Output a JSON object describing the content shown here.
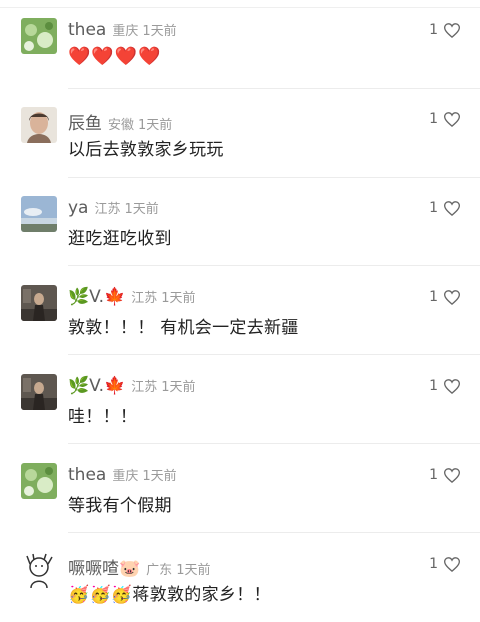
{
  "comments": [
    {
      "username": "thea",
      "location": "重庆",
      "time": "1天前",
      "text": "❤️❤️❤️❤️",
      "likes": "1",
      "avatar": "plant-avatar"
    },
    {
      "username": "辰鱼",
      "location": "安徽",
      "time": "1天前",
      "text": "以后去敦敦家乡玩玩",
      "likes": "1",
      "avatar": "portrait-avatar"
    },
    {
      "username": "ya",
      "location": "江苏",
      "time": "1天前",
      "text": "逛吃逛吃收到",
      "likes": "1",
      "avatar": "sky-avatar"
    },
    {
      "username": "🌿V.🍁",
      "location": "江苏",
      "time": "1天前",
      "text": "敦敦！！！ 有机会一定去新疆",
      "likes": "1",
      "avatar": "dark-portrait-avatar"
    },
    {
      "username": "🌿V.🍁",
      "location": "江苏",
      "time": "1天前",
      "text": "哇！！！",
      "likes": "1",
      "avatar": "dark-portrait-avatar"
    },
    {
      "username": "thea",
      "location": "重庆",
      "time": "1天前",
      "text": "等我有个假期",
      "likes": "1",
      "avatar": "plant-avatar"
    },
    {
      "username": "噘噘喳🐷",
      "location": "广东",
      "time": "1天前",
      "text": "🥳🥳🥳蒋敦敦的家乡！！",
      "likes": "1",
      "avatar": "sketch-avatar"
    }
  ]
}
